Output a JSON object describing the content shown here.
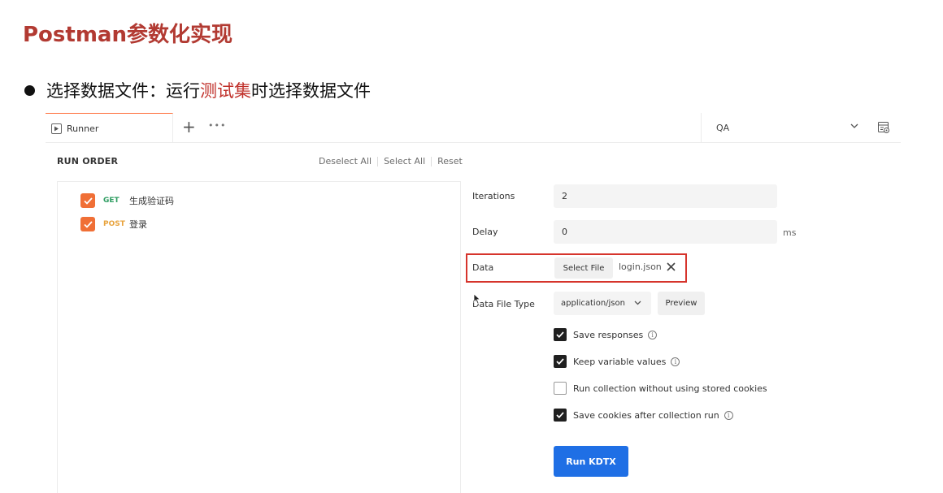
{
  "slide": {
    "title": "Postman参数化实现",
    "bullet_prefix": "选择数据文件：运行",
    "bullet_highlight": "测试集",
    "bullet_suffix": "时选择数据文件"
  },
  "tabs": {
    "runner_label": "Runner",
    "add_label": "+",
    "more_label": "•••",
    "environment": "QA"
  },
  "run_order": {
    "label": "RUN ORDER",
    "deselect_all": "Deselect All",
    "select_all": "Select All",
    "reset": "Reset",
    "requests": [
      {
        "method": "GET",
        "name": "生成验证码",
        "checked": true
      },
      {
        "method": "POST",
        "name": "登录",
        "checked": true
      }
    ]
  },
  "settings": {
    "iterations_label": "Iterations",
    "iterations_value": "2",
    "delay_label": "Delay",
    "delay_value": "0",
    "delay_unit": "ms",
    "data_label": "Data",
    "select_file_label": "Select File",
    "file_name": "login.json",
    "data_file_type_label": "Data File Type",
    "data_file_type_value": "application/json",
    "preview_label": "Preview",
    "options": [
      {
        "label": "Save responses",
        "checked": true,
        "info": true
      },
      {
        "label": "Keep variable values",
        "checked": true,
        "info": true
      },
      {
        "label": "Run collection without using stored cookies",
        "checked": false,
        "info": false
      },
      {
        "label": "Save cookies after collection run",
        "checked": true,
        "info": true
      }
    ],
    "run_button_label": "Run KDTX"
  },
  "colors": {
    "slide_title": "#b23a32",
    "highlight": "#c0302a",
    "checkbox_orange": "#f06f36",
    "get_method": "#2f9d62",
    "post_method": "#e8a33d",
    "annotation_box": "#d6342c",
    "run_button": "#1f6fe5"
  }
}
